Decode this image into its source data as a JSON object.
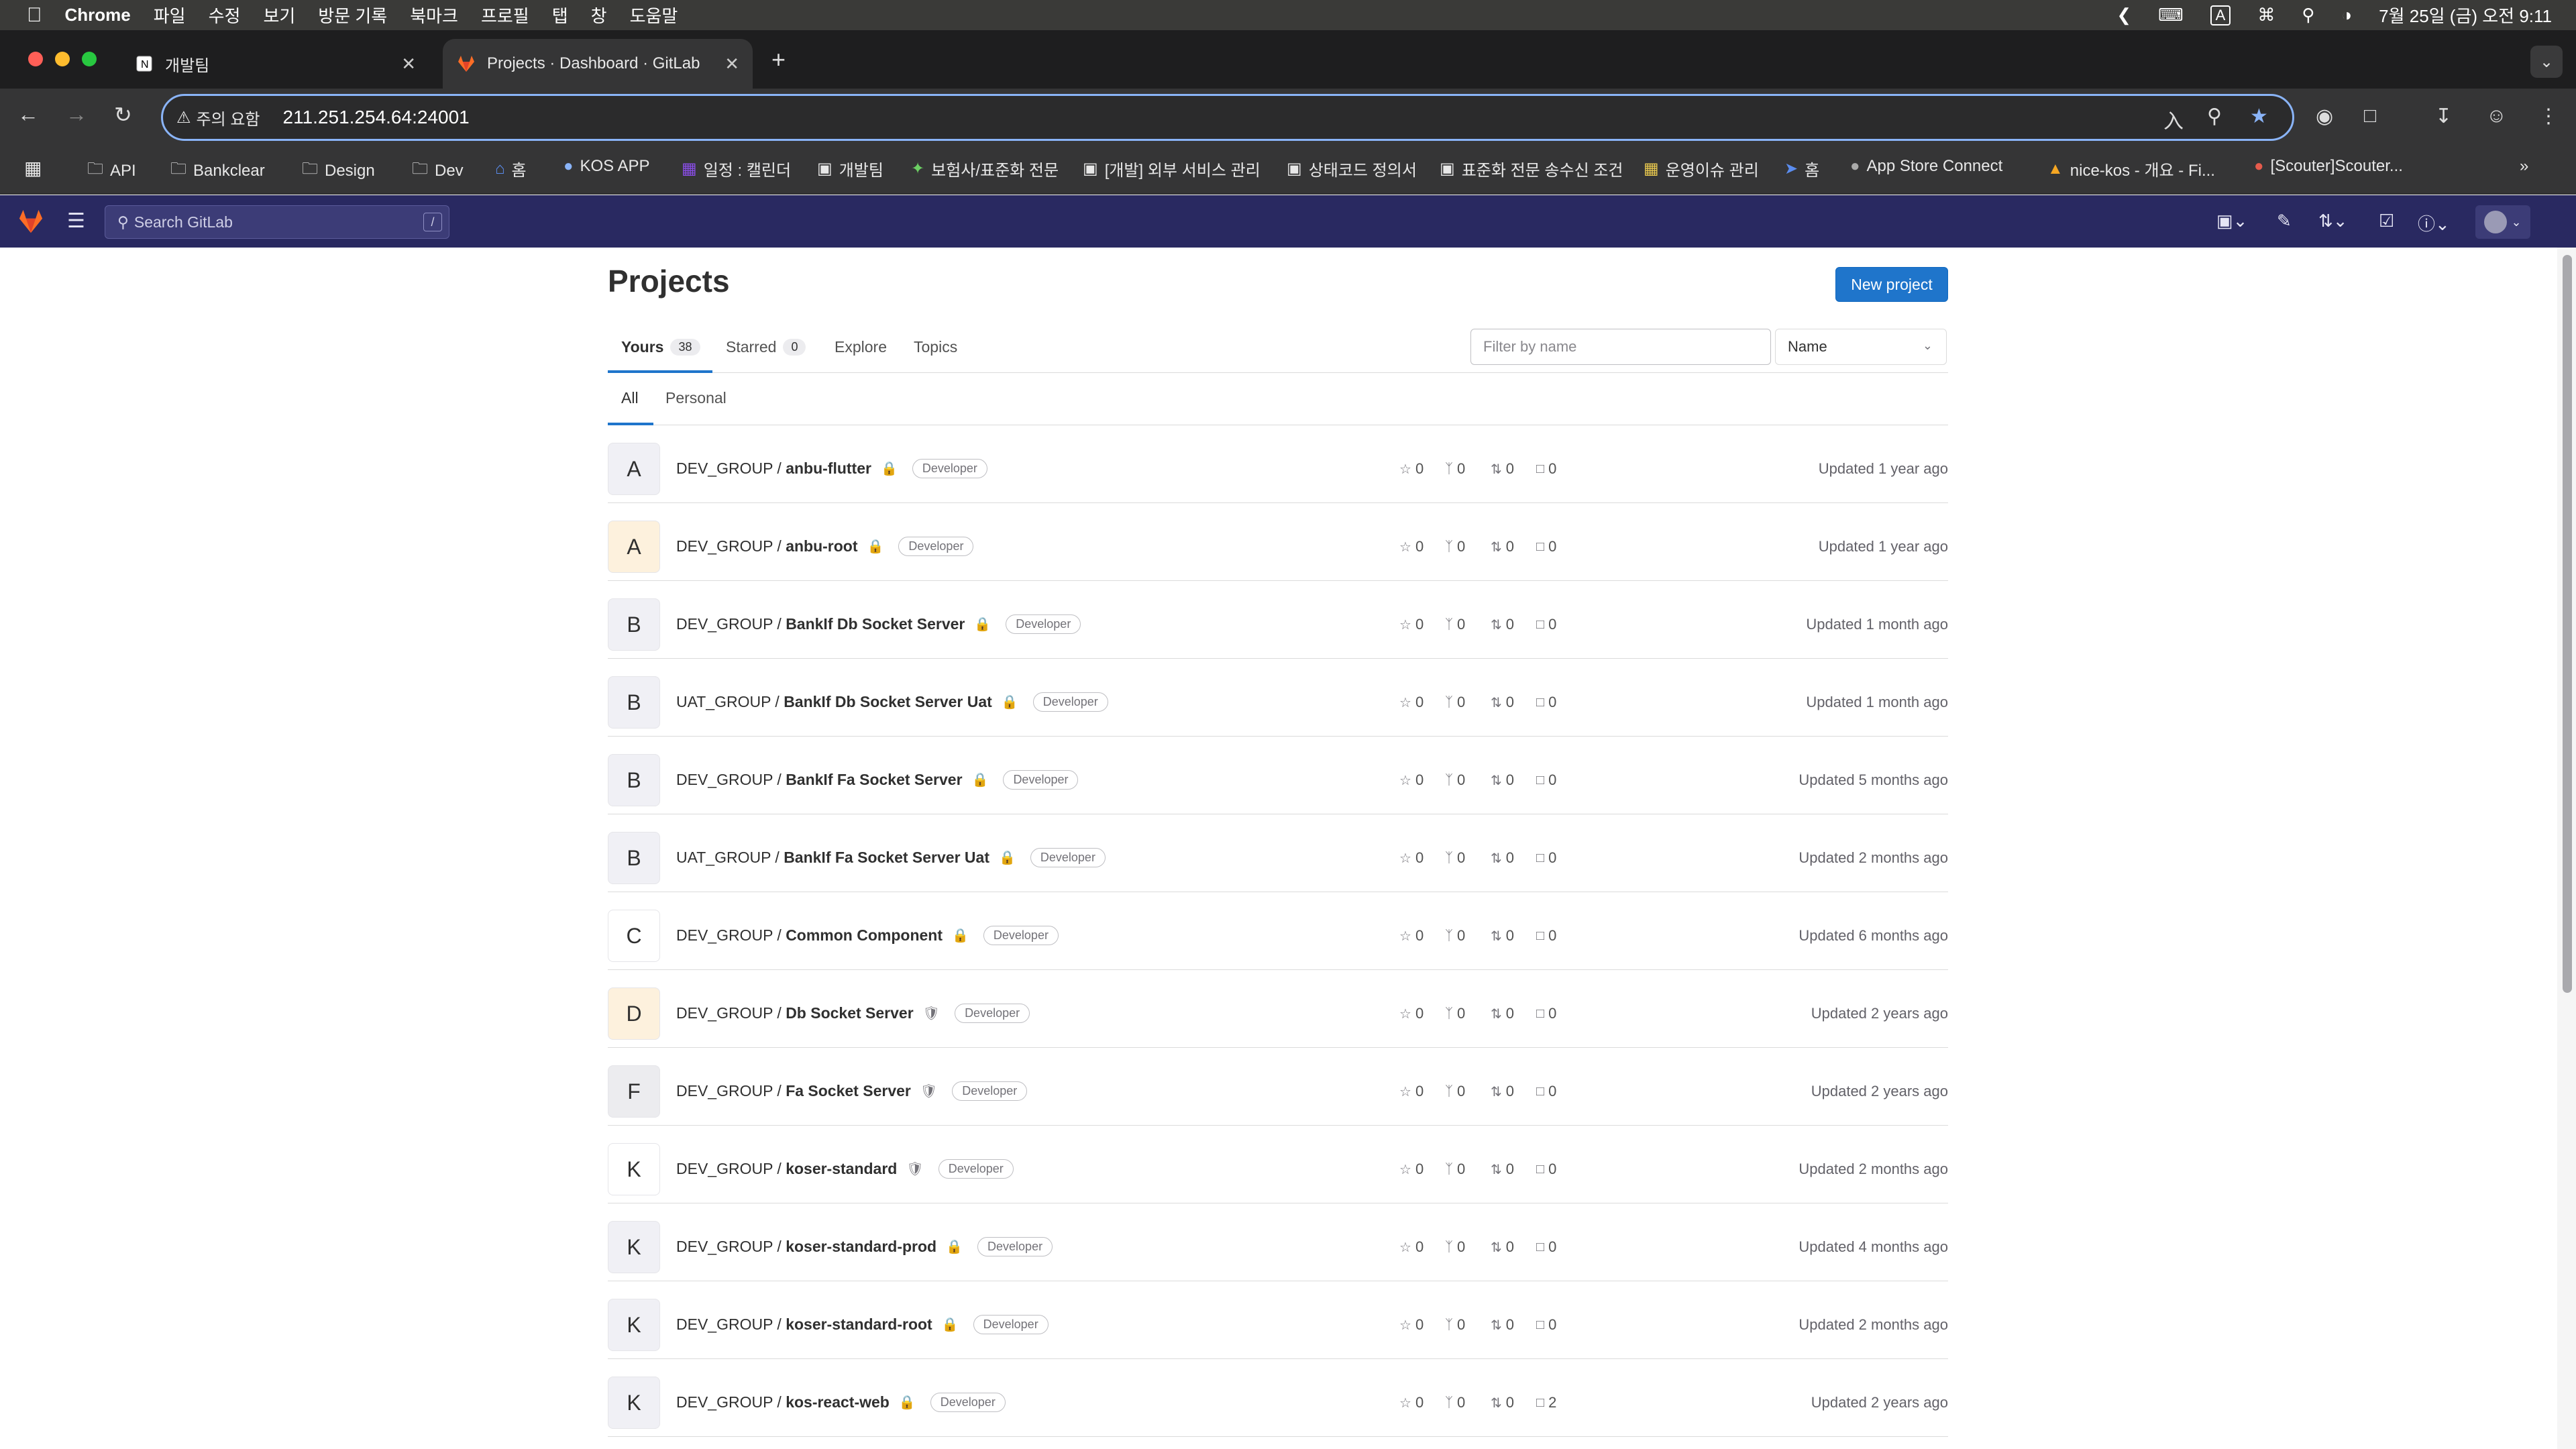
{
  "menubar": {
    "app": "Chrome",
    "menus": [
      "파일",
      "수정",
      "보기",
      "방문 기록",
      "북마크",
      "프로필",
      "탭",
      "창",
      "도움말"
    ],
    "clock": "7월 25일 (금) 오전 9:11",
    "input_indicator": "A"
  },
  "browser": {
    "tabs": [
      {
        "title": "개발팀",
        "active": false
      },
      {
        "title": "Projects · Dashboard · GitLab",
        "active": true
      }
    ],
    "omnibox": {
      "security_label": "주의 요함",
      "url": "211.251.254.64:24001"
    },
    "bookmarks": [
      {
        "label": "API",
        "icon": "folder-icon"
      },
      {
        "label": "Bankclear",
        "icon": "folder-icon"
      },
      {
        "label": "Design",
        "icon": "folder-icon"
      },
      {
        "label": "Dev",
        "icon": "folder-icon"
      },
      {
        "label": "홈",
        "icon": "home-icon"
      },
      {
        "label": "KOS APP",
        "icon": "app-icon"
      },
      {
        "label": "일정 : 캘린더",
        "icon": "calendar-icon"
      },
      {
        "label": "개발팀",
        "icon": "notion-icon"
      },
      {
        "label": "보험사/표준화 전문",
        "icon": "puzzle-icon"
      },
      {
        "label": "[개발] 외부 서비스 관리",
        "icon": "notion-icon"
      },
      {
        "label": "상태코드 정의서",
        "icon": "notion-icon"
      },
      {
        "label": "표준화 전문 송수신 조건",
        "icon": "notion-icon"
      },
      {
        "label": "운영이슈 관리",
        "icon": "image-icon"
      },
      {
        "label": "홈",
        "icon": "home-icon"
      },
      {
        "label": "App Store Connect",
        "icon": "apple-icon"
      },
      {
        "label": "nice-kos - 개요 - Fi...",
        "icon": "firebase-icon"
      },
      {
        "label": "[Scouter]Scouter...",
        "icon": "scouter-icon"
      }
    ]
  },
  "gitlab": {
    "search_placeholder": "Search GitLab",
    "search_shortcut": "/",
    "page_title": "Projects",
    "new_project_label": "New project",
    "tabs": [
      {
        "label": "Yours",
        "count": "38",
        "active": true
      },
      {
        "label": "Starred",
        "count": "0",
        "active": false
      },
      {
        "label": "Explore",
        "count": null,
        "active": false
      },
      {
        "label": "Topics",
        "count": null,
        "active": false
      }
    ],
    "filter_placeholder": "Filter by name",
    "sort_value": "Name",
    "subtabs": [
      {
        "label": "All",
        "active": true
      },
      {
        "label": "Personal",
        "active": false
      }
    ],
    "projects": [
      {
        "letter": "A",
        "avatar_bg": "#f0f0f5",
        "namespace": "DEV_GROUP / ",
        "name": "anbu-flutter",
        "visibility": "lock",
        "role": "Developer",
        "stars": "0",
        "forks": "0",
        "mrs": "0",
        "issues": "0",
        "updated": "Updated 1 year ago"
      },
      {
        "letter": "A",
        "avatar_bg": "#fdf1dd",
        "namespace": "DEV_GROUP / ",
        "name": "anbu-root",
        "visibility": "lock",
        "role": "Developer",
        "stars": "0",
        "forks": "0",
        "mrs": "0",
        "issues": "0",
        "updated": "Updated 1 year ago"
      },
      {
        "letter": "B",
        "avatar_bg": "#f0f0f5",
        "namespace": "DEV_GROUP / ",
        "name": "BankIf Db Socket Server",
        "visibility": "lock",
        "role": "Developer",
        "stars": "0",
        "forks": "0",
        "mrs": "0",
        "issues": "0",
        "updated": "Updated 1 month ago"
      },
      {
        "letter": "B",
        "avatar_bg": "#f0f0f5",
        "namespace": "UAT_GROUP / ",
        "name": "BankIf Db Socket Server Uat",
        "visibility": "lock",
        "role": "Developer",
        "stars": "0",
        "forks": "0",
        "mrs": "0",
        "issues": "0",
        "updated": "Updated 1 month ago"
      },
      {
        "letter": "B",
        "avatar_bg": "#f0f0f5",
        "namespace": "DEV_GROUP / ",
        "name": "BankIf Fa Socket Server",
        "visibility": "lock",
        "role": "Developer",
        "stars": "0",
        "forks": "0",
        "mrs": "0",
        "issues": "0",
        "updated": "Updated 5 months ago"
      },
      {
        "letter": "B",
        "avatar_bg": "#f0f0f5",
        "namespace": "UAT_GROUP / ",
        "name": "BankIf Fa Socket Server Uat",
        "visibility": "lock",
        "role": "Developer",
        "stars": "0",
        "forks": "0",
        "mrs": "0",
        "issues": "0",
        "updated": "Updated 2 months ago"
      },
      {
        "letter": "C",
        "avatar_bg": "#ffffff",
        "namespace": "DEV_GROUP / ",
        "name": "Common Component",
        "visibility": "lock",
        "role": "Developer",
        "stars": "0",
        "forks": "0",
        "mrs": "0",
        "issues": "0",
        "updated": "Updated 6 months ago"
      },
      {
        "letter": "D",
        "avatar_bg": "#fdf1dd",
        "namespace": "DEV_GROUP / ",
        "name": "Db Socket Server",
        "visibility": "shield",
        "role": "Developer",
        "stars": "0",
        "forks": "0",
        "mrs": "0",
        "issues": "0",
        "updated": "Updated 2 years ago"
      },
      {
        "letter": "F",
        "avatar_bg": "#ececef",
        "namespace": "DEV_GROUP / ",
        "name": "Fa Socket Server",
        "visibility": "shield",
        "role": "Developer",
        "stars": "0",
        "forks": "0",
        "mrs": "0",
        "issues": "0",
        "updated": "Updated 2 years ago"
      },
      {
        "letter": "K",
        "avatar_bg": "#ffffff",
        "namespace": "DEV_GROUP / ",
        "name": "koser-standard",
        "visibility": "shield",
        "role": "Developer",
        "stars": "0",
        "forks": "0",
        "mrs": "0",
        "issues": "0",
        "updated": "Updated 2 months ago"
      },
      {
        "letter": "K",
        "avatar_bg": "#f0f0f5",
        "namespace": "DEV_GROUP / ",
        "name": "koser-standard-prod",
        "visibility": "lock",
        "role": "Developer",
        "stars": "0",
        "forks": "0",
        "mrs": "0",
        "issues": "0",
        "updated": "Updated 4 months ago"
      },
      {
        "letter": "K",
        "avatar_bg": "#f0f0f5",
        "namespace": "DEV_GROUP / ",
        "name": "koser-standard-root",
        "visibility": "lock",
        "role": "Developer",
        "stars": "0",
        "forks": "0",
        "mrs": "0",
        "issues": "0",
        "updated": "Updated 2 months ago"
      },
      {
        "letter": "K",
        "avatar_bg": "#f0f0f5",
        "namespace": "DEV_GROUP / ",
        "name": "kos-react-web",
        "visibility": "lock",
        "role": "Developer",
        "stars": "0",
        "forks": "0",
        "mrs": "0",
        "issues": "2",
        "updated": "Updated 2 years ago"
      }
    ]
  },
  "colors": {
    "gitlab_header": "#292961",
    "primary_button": "#1f75cb",
    "chrome_dark": "#353536"
  }
}
